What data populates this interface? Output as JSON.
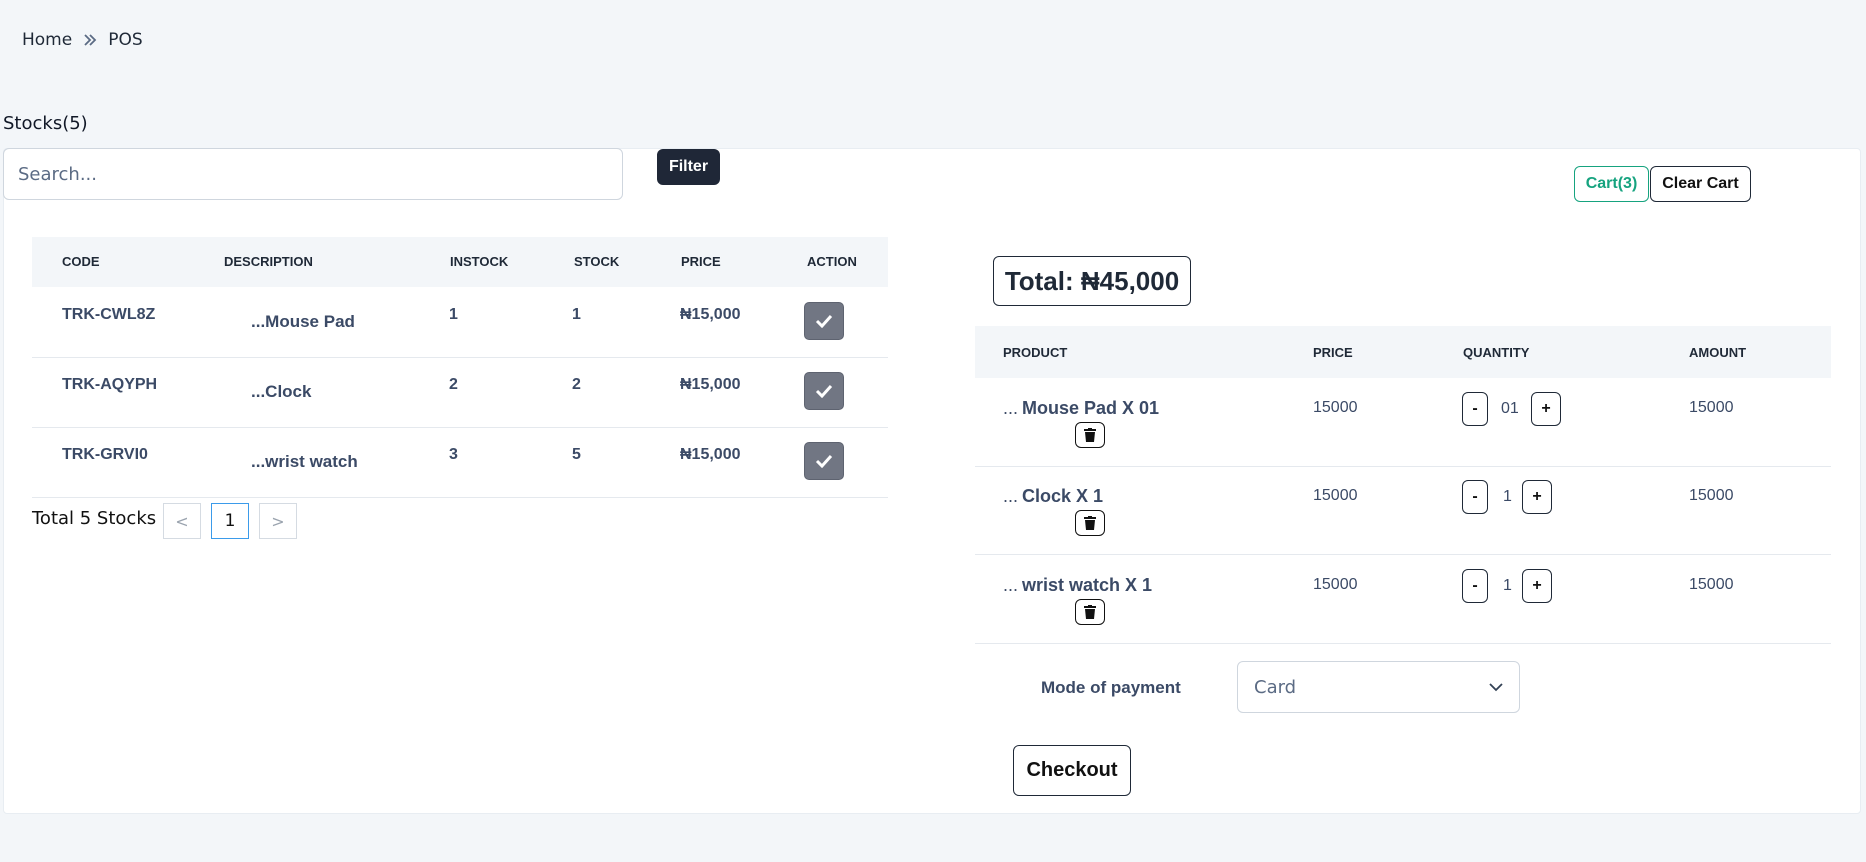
{
  "breadcrumb": {
    "home": "Home",
    "current": "POS"
  },
  "stocks": {
    "title": "Stocks(5)",
    "search_placeholder": "Search...",
    "filter_label": "Filter",
    "columns": [
      "CODE",
      "DESCRIPTION",
      "INSTOCK",
      "STOCK",
      "PRICE",
      "ACTION"
    ],
    "rows": [
      {
        "code": "TRK-CWL8Z",
        "description": "...Mouse Pad",
        "instock": "1",
        "stock": "1",
        "price": "₦15,000"
      },
      {
        "code": "TRK-AQYPH",
        "description": "...Clock",
        "instock": "2",
        "stock": "2",
        "price": "₦15,000"
      },
      {
        "code": "TRK-GRVI0",
        "description": "...wrist watch",
        "instock": "3",
        "stock": "5",
        "price": "₦15,000"
      }
    ],
    "pager": {
      "total_text": "Total 5 Stocks",
      "prev": "<",
      "page": "1",
      "next": ">"
    }
  },
  "cart": {
    "cart_label": "Cart(3)",
    "clear_label": "Clear Cart",
    "total": "Total: ₦45,000",
    "columns": [
      "PRODUCT",
      "PRICE",
      "QUANTITY",
      "AMOUNT"
    ],
    "items": [
      {
        "dots": "...",
        "name": "Mouse Pad X 01",
        "price": "15000",
        "qty": "01",
        "amount": "15000",
        "minus": "-",
        "plus": "+"
      },
      {
        "dots": "...",
        "name": "Clock X 1",
        "price": "15000",
        "qty": "1",
        "amount": "15000",
        "minus": "-",
        "plus": "+"
      },
      {
        "dots": "...",
        "name": "wrist watch X 1",
        "price": "15000",
        "qty": "1",
        "amount": "15000",
        "minus": "-",
        "plus": "+"
      }
    ],
    "mode_of_payment_label": "Mode of payment",
    "mode_of_payment_value": "Card",
    "checkout_label": "Checkout"
  },
  "colors": {
    "accent_green": "#16a37f",
    "dark": "#1f2737",
    "check_button": "#717683"
  }
}
